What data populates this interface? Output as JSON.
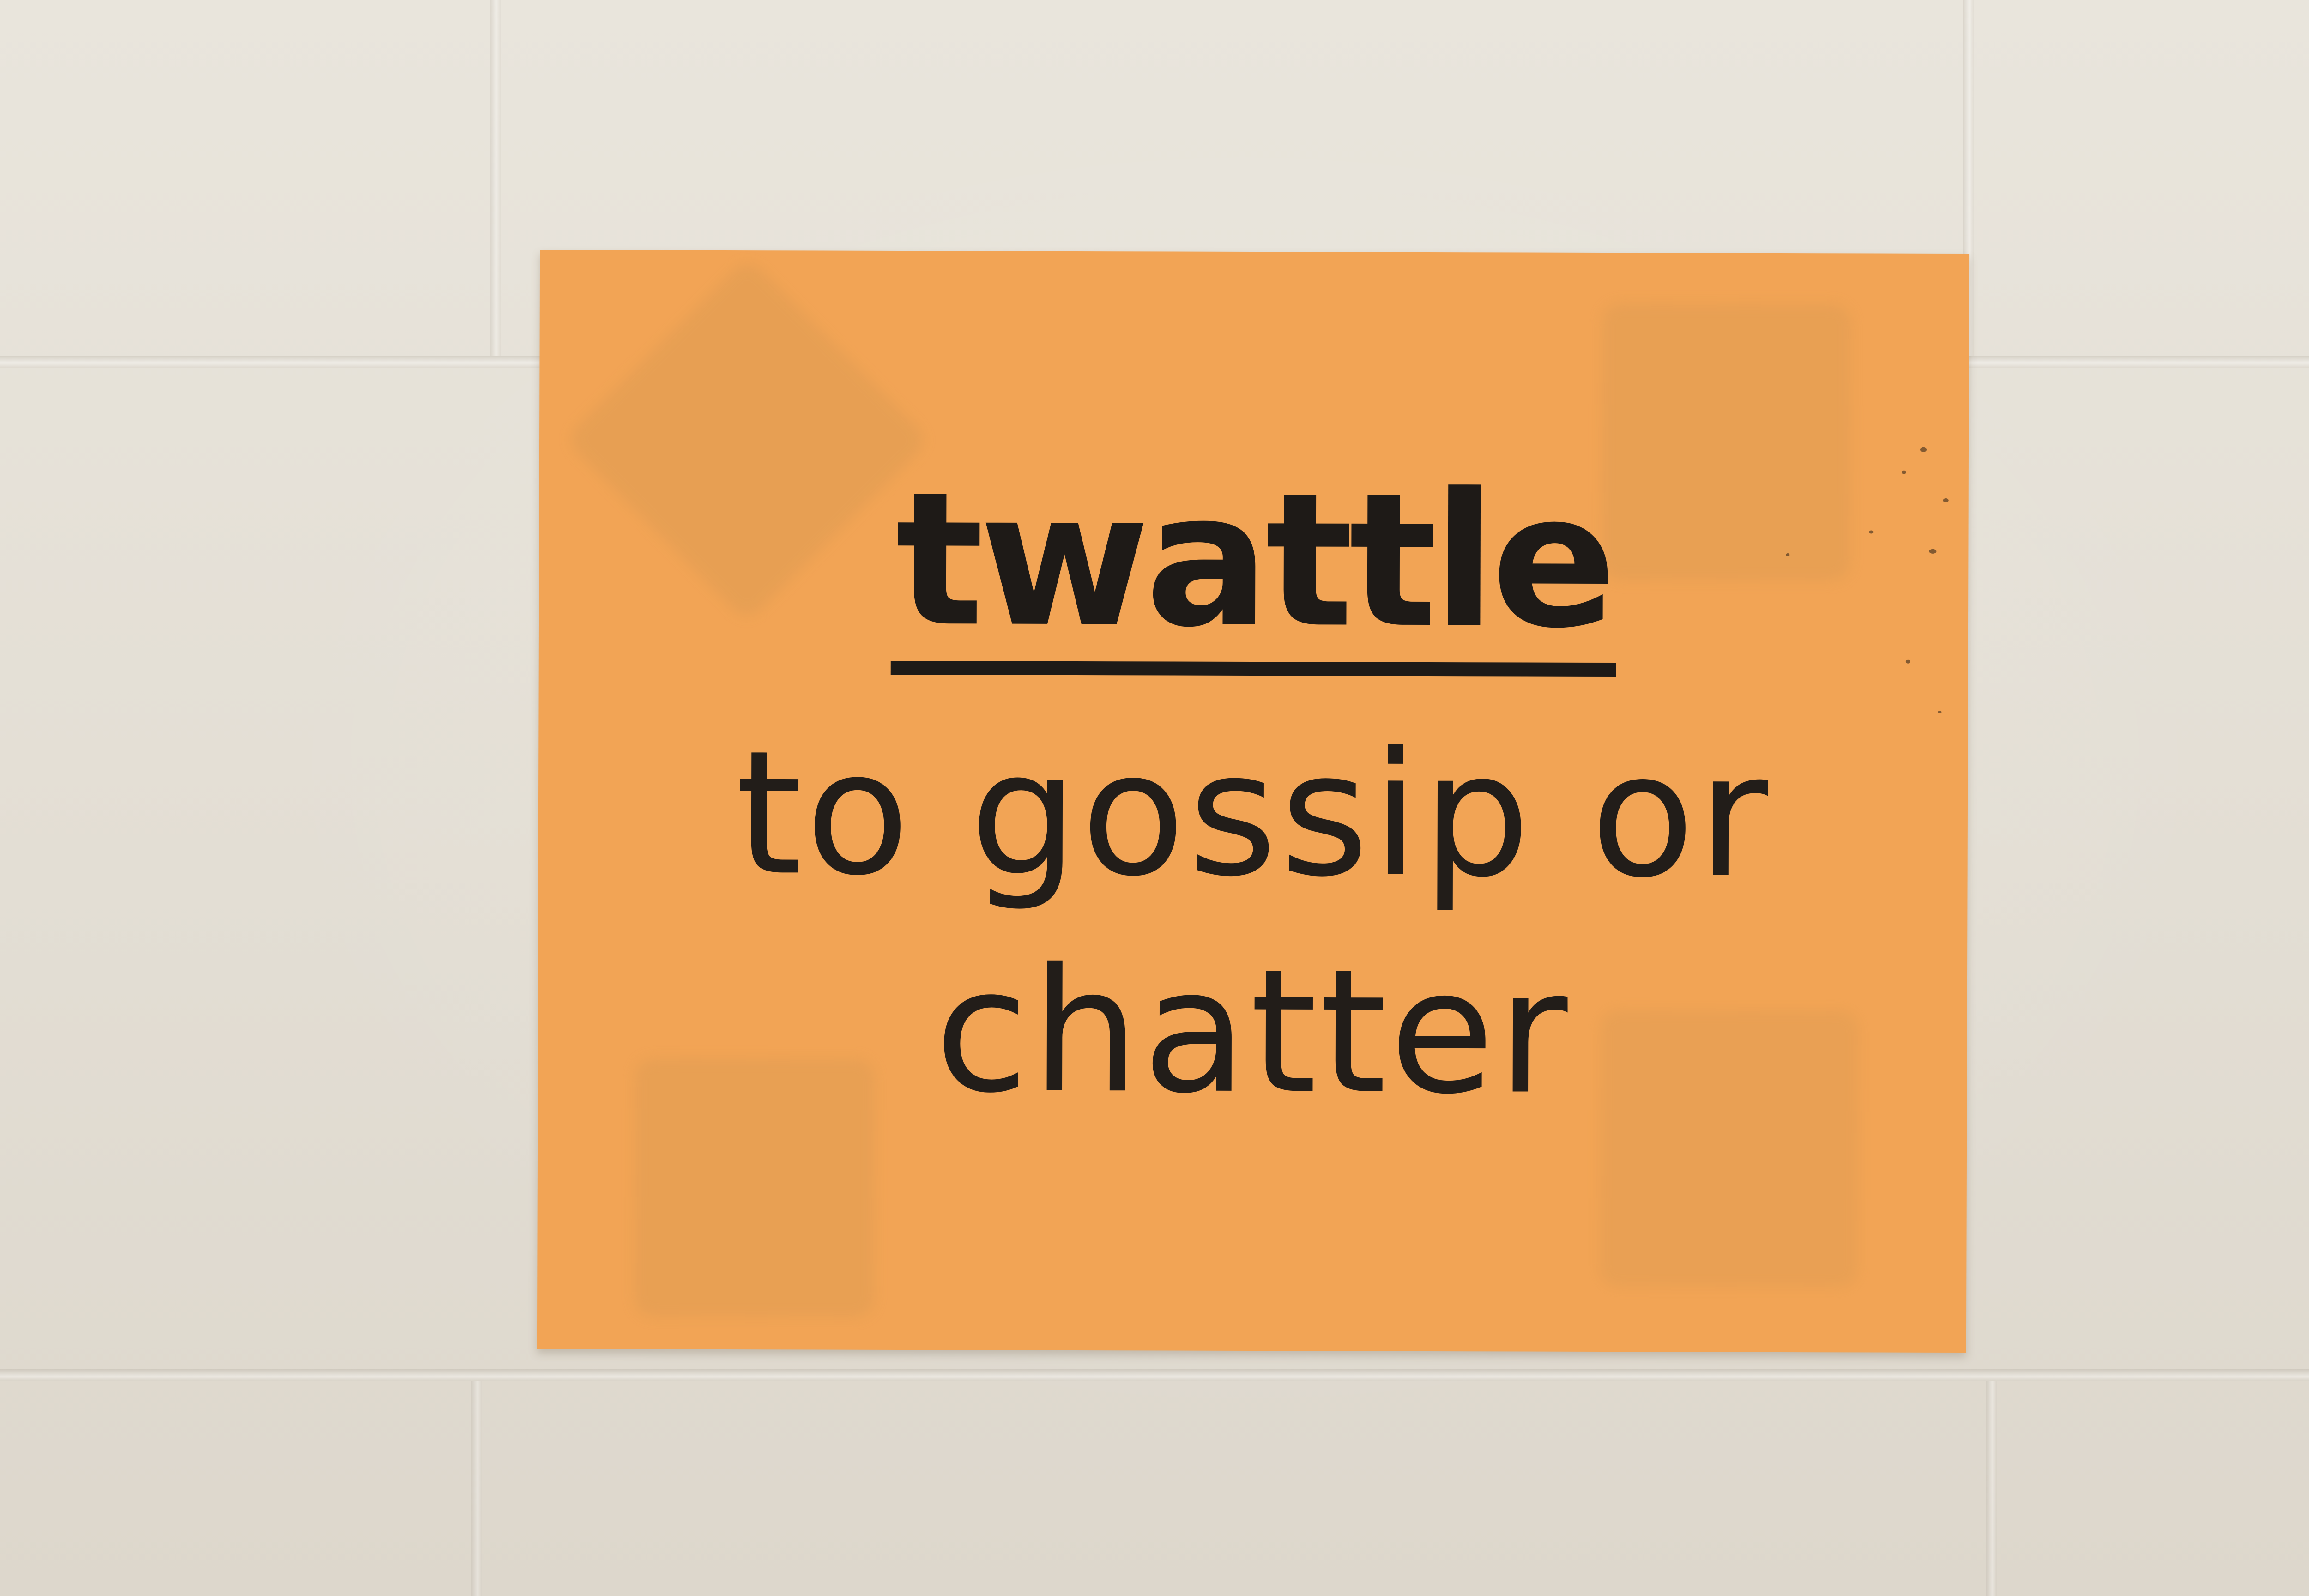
{
  "sign": {
    "word": "twattle",
    "definition_line1": "to gossip or",
    "definition_line2": "chatter"
  },
  "colors": {
    "sign_background": "#f2a455",
    "text": "#1e1a17",
    "wall": "#e6e1d8"
  }
}
